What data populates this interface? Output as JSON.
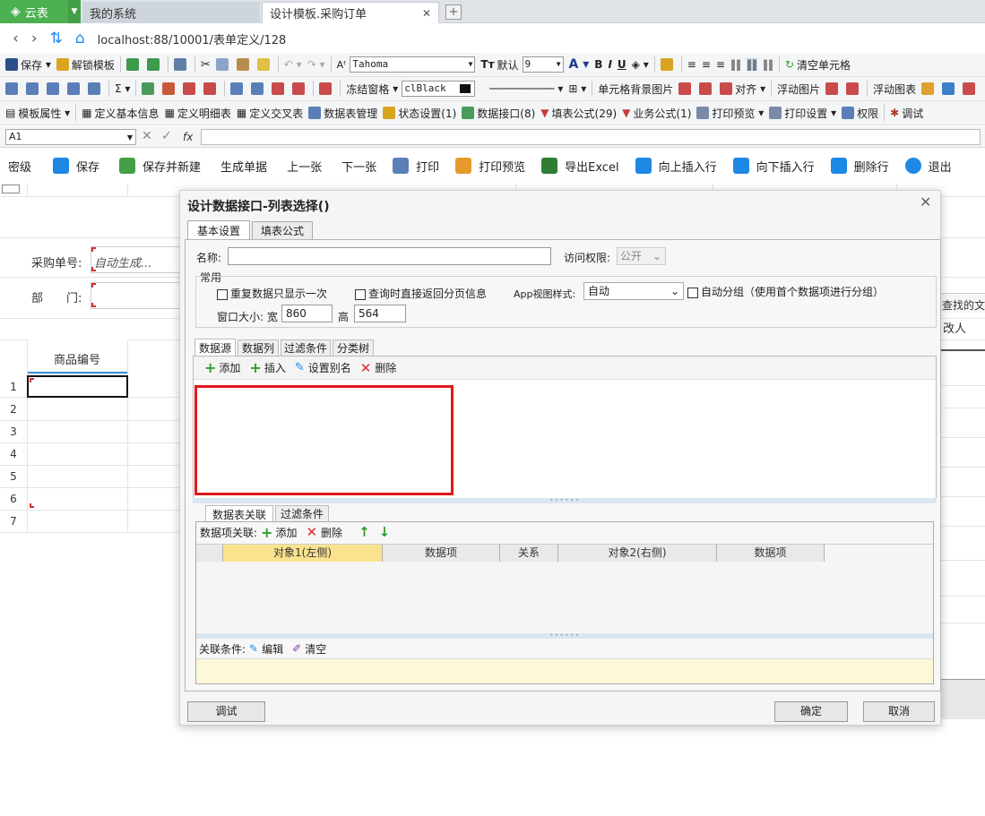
{
  "browser": {
    "app_tab": "云表",
    "tabs": [
      {
        "label": "我的系统"
      },
      {
        "label": "设计模板.采购订单"
      }
    ],
    "url": "localhost:88/10001/表单定义/128"
  },
  "toolbar1": {
    "save": "保存",
    "unlock_template": "解锁模板",
    "font_name": "Tahoma",
    "default": "默认",
    "font_size": "9",
    "clear_cell": "清空单元格"
  },
  "toolbar2": {
    "freeze": "冻结窗格",
    "color": "clBlack",
    "cell_bg_image": "单元格背景图片",
    "align": "对齐",
    "float_image": "浮动图片",
    "float_chart": "浮动图表"
  },
  "toolbar3": {
    "template_props": "模板属性",
    "define_basic": "定义基本信息",
    "define_detail": "定义明细表",
    "define_cross": "定义交叉表",
    "datatable_mgmt": "数据表管理",
    "state_settings": "状态设置(1)",
    "data_interface": "数据接口(8)",
    "fill_formula": "填表公式(29)",
    "biz_formula": "业务公式(1)",
    "print_preview": "打印预览",
    "print_settings": "打印设置",
    "permission": "权限",
    "debug": "调试"
  },
  "formula_bar": {
    "cell_ref": "A1",
    "fx": "fx"
  },
  "action_bar": [
    {
      "label": "密级",
      "color": ""
    },
    {
      "label": "保存",
      "color": "#1e88e5"
    },
    {
      "label": "保存并新建",
      "color": "#43a047"
    },
    {
      "label": "生成单据",
      "color": ""
    },
    {
      "label": "上一张",
      "color": ""
    },
    {
      "label": "下一张",
      "color": ""
    },
    {
      "label": "打印",
      "color": "#5c7fb5"
    },
    {
      "label": "打印预览",
      "color": "#e59a2b"
    },
    {
      "label": "导出Excel",
      "color": "#2e7d32"
    },
    {
      "label": "向上插入行",
      "color": "#1e88e5"
    },
    {
      "label": "向下插入行",
      "color": "#1e88e5"
    },
    {
      "label": "删除行",
      "color": "#1e88e5"
    },
    {
      "label": "退出",
      "color": "#1e88e5"
    }
  ],
  "sheet": {
    "purchase_no_label": "采购单号:",
    "purchase_no_value": "自动生成...",
    "department_label": "部　　门:",
    "product_code_header": "商品编号",
    "right_header_partial": "查找的文",
    "right_header_partial2": "改人",
    "rows": [
      "1",
      "2",
      "3",
      "4",
      "5",
      "6",
      "7"
    ]
  },
  "dialog": {
    "title": "设计数据接口-列表选择()",
    "tabs": [
      "基本设置",
      "填表公式"
    ],
    "name_label": "名称:",
    "name_value": "",
    "access_label": "访问权限:",
    "access_value": "公开",
    "group_common": "常用",
    "chk_dup_once": "重复数据只显示一次",
    "chk_paging": "查询时直接返回分页信息",
    "app_view_label": "App视图样式:",
    "app_view_value": "自动",
    "chk_autogroup": "自动分组（使用首个数据项进行分组）",
    "window_size_label": "窗口大小: 宽",
    "width_value": "860",
    "height_label": "高",
    "height_value": "564",
    "source_tabs": [
      "数据源",
      "数据列",
      "过滤条件",
      "分类树"
    ],
    "source_toolbar": {
      "add": "添加",
      "insert": "插入",
      "alias": "设置别名",
      "delete": "删除"
    },
    "relation_tabs": [
      "数据表关联",
      "过滤条件"
    ],
    "relation_label": "数据项关联:",
    "relation_add": "添加",
    "relation_delete": "删除",
    "relation_columns": [
      "对象1(左侧)",
      "数据项",
      "关系",
      "对象2(右侧)",
      "数据项"
    ],
    "cond_label": "关联条件:",
    "cond_edit": "编辑",
    "cond_clear": "清空",
    "btn_debug": "调试",
    "btn_ok": "确定",
    "btn_cancel": "取消"
  }
}
